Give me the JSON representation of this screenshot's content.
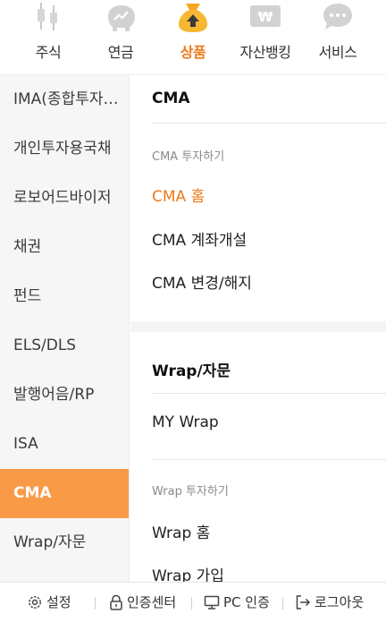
{
  "topnav": {
    "tabs": [
      {
        "label": "주식",
        "icon": "candlestick-icon"
      },
      {
        "label": "연금",
        "icon": "piggy-bank-icon"
      },
      {
        "label": "상품",
        "icon": "money-bag-icon",
        "active": true
      },
      {
        "label": "자산뱅킹",
        "icon": "won-card-icon"
      },
      {
        "label": "서비스",
        "icon": "chat-bubble-icon"
      }
    ]
  },
  "leftmenu": {
    "items": [
      {
        "label": "IMA(종합투자계좌)"
      },
      {
        "label": "개인투자용국채"
      },
      {
        "label": "로보어드바이저"
      },
      {
        "label": "채권"
      },
      {
        "label": "펀드"
      },
      {
        "label": "ELS/DLS"
      },
      {
        "label": "발행어음/RP"
      },
      {
        "label": "ISA"
      },
      {
        "label": "CMA",
        "active": true
      },
      {
        "label": "Wrap/자문"
      }
    ]
  },
  "content": {
    "cma": {
      "title": "CMA",
      "subheading": "CMA 투자하기",
      "links": [
        "CMA 홈",
        "CMA 계좌개설",
        "CMA 변경/해지"
      ]
    },
    "wrap": {
      "title": "Wrap/자문",
      "my_wrap": "MY Wrap",
      "subheading": "Wrap 투자하기",
      "links": [
        "Wrap 홈",
        "Wrap 가입"
      ]
    }
  },
  "bottombar": {
    "settings": "설정",
    "auth_center": "인증센터",
    "pc_auth": "PC 인증",
    "logout": "로그아웃"
  },
  "colors": {
    "accent": "#f07a1a",
    "active_bg": "#f99a47",
    "menu_bg": "#f6f6f6"
  }
}
